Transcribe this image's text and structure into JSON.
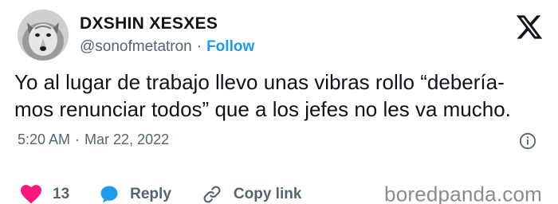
{
  "author": {
    "display_name": "DXSHIN XESXES",
    "handle": "@sonofmetatron",
    "separator": "·",
    "follow_label": "Follow"
  },
  "tweet": {
    "lines": [
      "Yo al lugar de trabajo llevo unas vibras rollo “debería-",
      "mos renunciar todos” que a los jefes no les va mucho."
    ],
    "time": "5:20 AM",
    "date_separator": "·",
    "date": "Mar 22, 2022"
  },
  "actions": {
    "like_count": "13",
    "reply_label": "Reply",
    "copy_link_label": "Copy link"
  },
  "watermark": "boredpanda.com",
  "colors": {
    "like": "#f91880",
    "reply": "#1d9bf0",
    "follow": "#1d9bf0",
    "muted": "#536471",
    "text": "#0f1419"
  },
  "icons": {
    "brand": "x-logo-icon",
    "like": "heart-icon",
    "reply": "speech-bubble-icon",
    "copy": "link-icon",
    "info": "info-icon"
  }
}
